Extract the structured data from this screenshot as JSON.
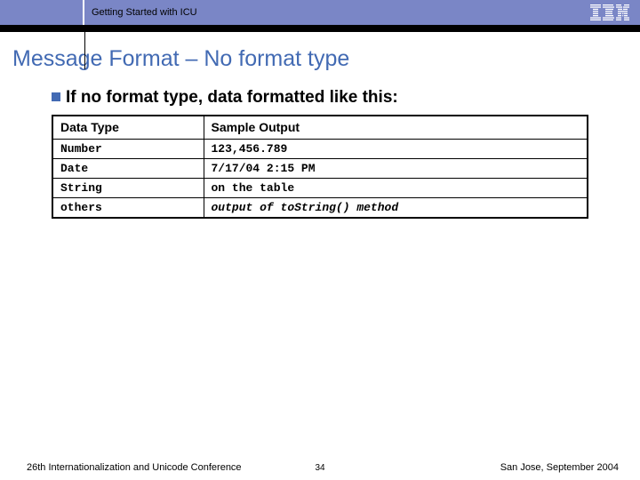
{
  "header": {
    "title": "Getting Started with ICU"
  },
  "slide": {
    "title": "Message Format – No format type",
    "bullet": "If no format type, data formatted like this:"
  },
  "table": {
    "headers": {
      "col1": "Data Type",
      "col2": "Sample Output"
    },
    "rows": [
      {
        "type": "Number",
        "output": "123,456.789"
      },
      {
        "type": "Date",
        "output": "7/17/04 2:15 PM"
      },
      {
        "type": "String",
        "output": "on the table"
      },
      {
        "type": "others",
        "output": "output of toString() method",
        "italic": true
      }
    ]
  },
  "footer": {
    "left": "26th Internationalization and Unicode Conference",
    "center": "34",
    "right": "San Jose, September 2004"
  }
}
